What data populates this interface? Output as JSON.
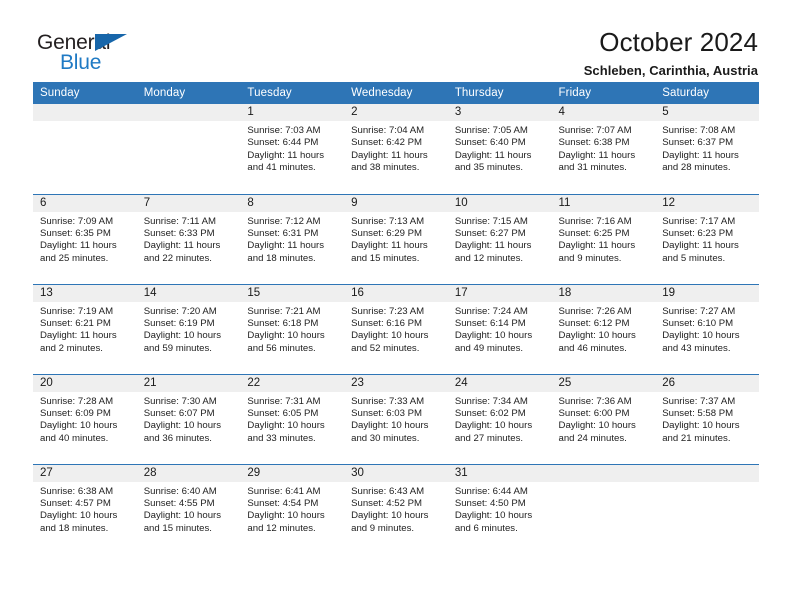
{
  "brand": {
    "name_top": "General",
    "name_bottom": "Blue",
    "accent_color": "#1f7ac4",
    "triangle_color": "#1766aa"
  },
  "header": {
    "title": "October 2024",
    "subtitle": "Schleben, Carinthia, Austria"
  },
  "theme": {
    "header_blue": "#2e75b6",
    "daynum_band": "#efefef",
    "cell_background": "#ffffff",
    "text": "#222222"
  },
  "weekdays": [
    "Sunday",
    "Monday",
    "Tuesday",
    "Wednesday",
    "Thursday",
    "Friday",
    "Saturday"
  ],
  "labels": {
    "sunrise_prefix": "Sunrise:",
    "sunset_prefix": "Sunset:",
    "daylight_prefix": "Daylight:"
  },
  "weeks": [
    [
      {
        "day": ""
      },
      {
        "day": ""
      },
      {
        "day": "1",
        "sunrise": "Sunrise: 7:03 AM",
        "sunset": "Sunset: 6:44 PM",
        "daylight_line1": "Daylight: 11 hours",
        "daylight_line2": "and 41 minutes."
      },
      {
        "day": "2",
        "sunrise": "Sunrise: 7:04 AM",
        "sunset": "Sunset: 6:42 PM",
        "daylight_line1": "Daylight: 11 hours",
        "daylight_line2": "and 38 minutes."
      },
      {
        "day": "3",
        "sunrise": "Sunrise: 7:05 AM",
        "sunset": "Sunset: 6:40 PM",
        "daylight_line1": "Daylight: 11 hours",
        "daylight_line2": "and 35 minutes."
      },
      {
        "day": "4",
        "sunrise": "Sunrise: 7:07 AM",
        "sunset": "Sunset: 6:38 PM",
        "daylight_line1": "Daylight: 11 hours",
        "daylight_line2": "and 31 minutes."
      },
      {
        "day": "5",
        "sunrise": "Sunrise: 7:08 AM",
        "sunset": "Sunset: 6:37 PM",
        "daylight_line1": "Daylight: 11 hours",
        "daylight_line2": "and 28 minutes."
      }
    ],
    [
      {
        "day": "6",
        "sunrise": "Sunrise: 7:09 AM",
        "sunset": "Sunset: 6:35 PM",
        "daylight_line1": "Daylight: 11 hours",
        "daylight_line2": "and 25 minutes."
      },
      {
        "day": "7",
        "sunrise": "Sunrise: 7:11 AM",
        "sunset": "Sunset: 6:33 PM",
        "daylight_line1": "Daylight: 11 hours",
        "daylight_line2": "and 22 minutes."
      },
      {
        "day": "8",
        "sunrise": "Sunrise: 7:12 AM",
        "sunset": "Sunset: 6:31 PM",
        "daylight_line1": "Daylight: 11 hours",
        "daylight_line2": "and 18 minutes."
      },
      {
        "day": "9",
        "sunrise": "Sunrise: 7:13 AM",
        "sunset": "Sunset: 6:29 PM",
        "daylight_line1": "Daylight: 11 hours",
        "daylight_line2": "and 15 minutes."
      },
      {
        "day": "10",
        "sunrise": "Sunrise: 7:15 AM",
        "sunset": "Sunset: 6:27 PM",
        "daylight_line1": "Daylight: 11 hours",
        "daylight_line2": "and 12 minutes."
      },
      {
        "day": "11",
        "sunrise": "Sunrise: 7:16 AM",
        "sunset": "Sunset: 6:25 PM",
        "daylight_line1": "Daylight: 11 hours",
        "daylight_line2": "and 9 minutes."
      },
      {
        "day": "12",
        "sunrise": "Sunrise: 7:17 AM",
        "sunset": "Sunset: 6:23 PM",
        "daylight_line1": "Daylight: 11 hours",
        "daylight_line2": "and 5 minutes."
      }
    ],
    [
      {
        "day": "13",
        "sunrise": "Sunrise: 7:19 AM",
        "sunset": "Sunset: 6:21 PM",
        "daylight_line1": "Daylight: 11 hours",
        "daylight_line2": "and 2 minutes."
      },
      {
        "day": "14",
        "sunrise": "Sunrise: 7:20 AM",
        "sunset": "Sunset: 6:19 PM",
        "daylight_line1": "Daylight: 10 hours",
        "daylight_line2": "and 59 minutes."
      },
      {
        "day": "15",
        "sunrise": "Sunrise: 7:21 AM",
        "sunset": "Sunset: 6:18 PM",
        "daylight_line1": "Daylight: 10 hours",
        "daylight_line2": "and 56 minutes."
      },
      {
        "day": "16",
        "sunrise": "Sunrise: 7:23 AM",
        "sunset": "Sunset: 6:16 PM",
        "daylight_line1": "Daylight: 10 hours",
        "daylight_line2": "and 52 minutes."
      },
      {
        "day": "17",
        "sunrise": "Sunrise: 7:24 AM",
        "sunset": "Sunset: 6:14 PM",
        "daylight_line1": "Daylight: 10 hours",
        "daylight_line2": "and 49 minutes."
      },
      {
        "day": "18",
        "sunrise": "Sunrise: 7:26 AM",
        "sunset": "Sunset: 6:12 PM",
        "daylight_line1": "Daylight: 10 hours",
        "daylight_line2": "and 46 minutes."
      },
      {
        "day": "19",
        "sunrise": "Sunrise: 7:27 AM",
        "sunset": "Sunset: 6:10 PM",
        "daylight_line1": "Daylight: 10 hours",
        "daylight_line2": "and 43 minutes."
      }
    ],
    [
      {
        "day": "20",
        "sunrise": "Sunrise: 7:28 AM",
        "sunset": "Sunset: 6:09 PM",
        "daylight_line1": "Daylight: 10 hours",
        "daylight_line2": "and 40 minutes."
      },
      {
        "day": "21",
        "sunrise": "Sunrise: 7:30 AM",
        "sunset": "Sunset: 6:07 PM",
        "daylight_line1": "Daylight: 10 hours",
        "daylight_line2": "and 36 minutes."
      },
      {
        "day": "22",
        "sunrise": "Sunrise: 7:31 AM",
        "sunset": "Sunset: 6:05 PM",
        "daylight_line1": "Daylight: 10 hours",
        "daylight_line2": "and 33 minutes."
      },
      {
        "day": "23",
        "sunrise": "Sunrise: 7:33 AM",
        "sunset": "Sunset: 6:03 PM",
        "daylight_line1": "Daylight: 10 hours",
        "daylight_line2": "and 30 minutes."
      },
      {
        "day": "24",
        "sunrise": "Sunrise: 7:34 AM",
        "sunset": "Sunset: 6:02 PM",
        "daylight_line1": "Daylight: 10 hours",
        "daylight_line2": "and 27 minutes."
      },
      {
        "day": "25",
        "sunrise": "Sunrise: 7:36 AM",
        "sunset": "Sunset: 6:00 PM",
        "daylight_line1": "Daylight: 10 hours",
        "daylight_line2": "and 24 minutes."
      },
      {
        "day": "26",
        "sunrise": "Sunrise: 7:37 AM",
        "sunset": "Sunset: 5:58 PM",
        "daylight_line1": "Daylight: 10 hours",
        "daylight_line2": "and 21 minutes."
      }
    ],
    [
      {
        "day": "27",
        "sunrise": "Sunrise: 6:38 AM",
        "sunset": "Sunset: 4:57 PM",
        "daylight_line1": "Daylight: 10 hours",
        "daylight_line2": "and 18 minutes."
      },
      {
        "day": "28",
        "sunrise": "Sunrise: 6:40 AM",
        "sunset": "Sunset: 4:55 PM",
        "daylight_line1": "Daylight: 10 hours",
        "daylight_line2": "and 15 minutes."
      },
      {
        "day": "29",
        "sunrise": "Sunrise: 6:41 AM",
        "sunset": "Sunset: 4:54 PM",
        "daylight_line1": "Daylight: 10 hours",
        "daylight_line2": "and 12 minutes."
      },
      {
        "day": "30",
        "sunrise": "Sunrise: 6:43 AM",
        "sunset": "Sunset: 4:52 PM",
        "daylight_line1": "Daylight: 10 hours",
        "daylight_line2": "and 9 minutes."
      },
      {
        "day": "31",
        "sunrise": "Sunrise: 6:44 AM",
        "sunset": "Sunset: 4:50 PM",
        "daylight_line1": "Daylight: 10 hours",
        "daylight_line2": "and 6 minutes."
      },
      {
        "day": ""
      },
      {
        "day": ""
      }
    ]
  ]
}
